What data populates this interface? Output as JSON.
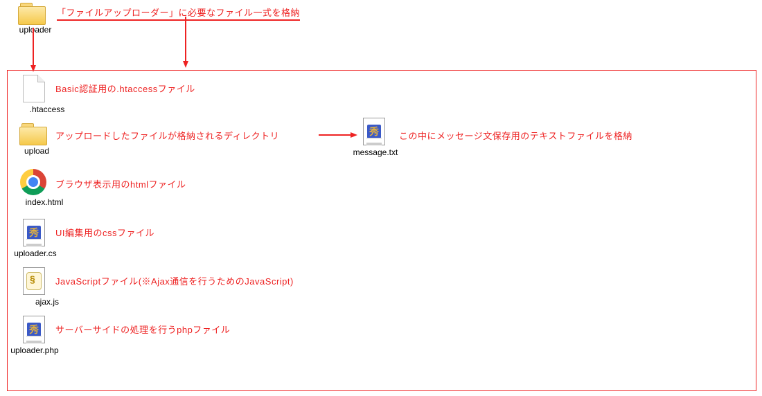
{
  "rootFolder": {
    "name": "uploader",
    "annotation": "「ファイルアップローダー」に必要なファイル一式を格納"
  },
  "contents": [
    {
      "name": ".htaccess",
      "desc": "Basic認証用の.htaccessファイル"
    },
    {
      "name": "upload",
      "desc": "アップロードしたファイルが格納されるディレクトリ"
    },
    {
      "name": "index.html",
      "desc": "ブラウザ表示用のhtmlファイル"
    },
    {
      "name": "uploader.cs",
      "desc": "UI編集用のcssファイル"
    },
    {
      "name": "ajax.js",
      "desc": "JavaScriptファイル(※Ajax通信を行うためのJavaScript)"
    },
    {
      "name": "uploader.php",
      "desc": "サーバーサイドの処理を行うphpファイル"
    }
  ],
  "nested": {
    "name": "message.txt",
    "desc": "この中にメッセージ文保存用のテキストファイルを格納"
  }
}
